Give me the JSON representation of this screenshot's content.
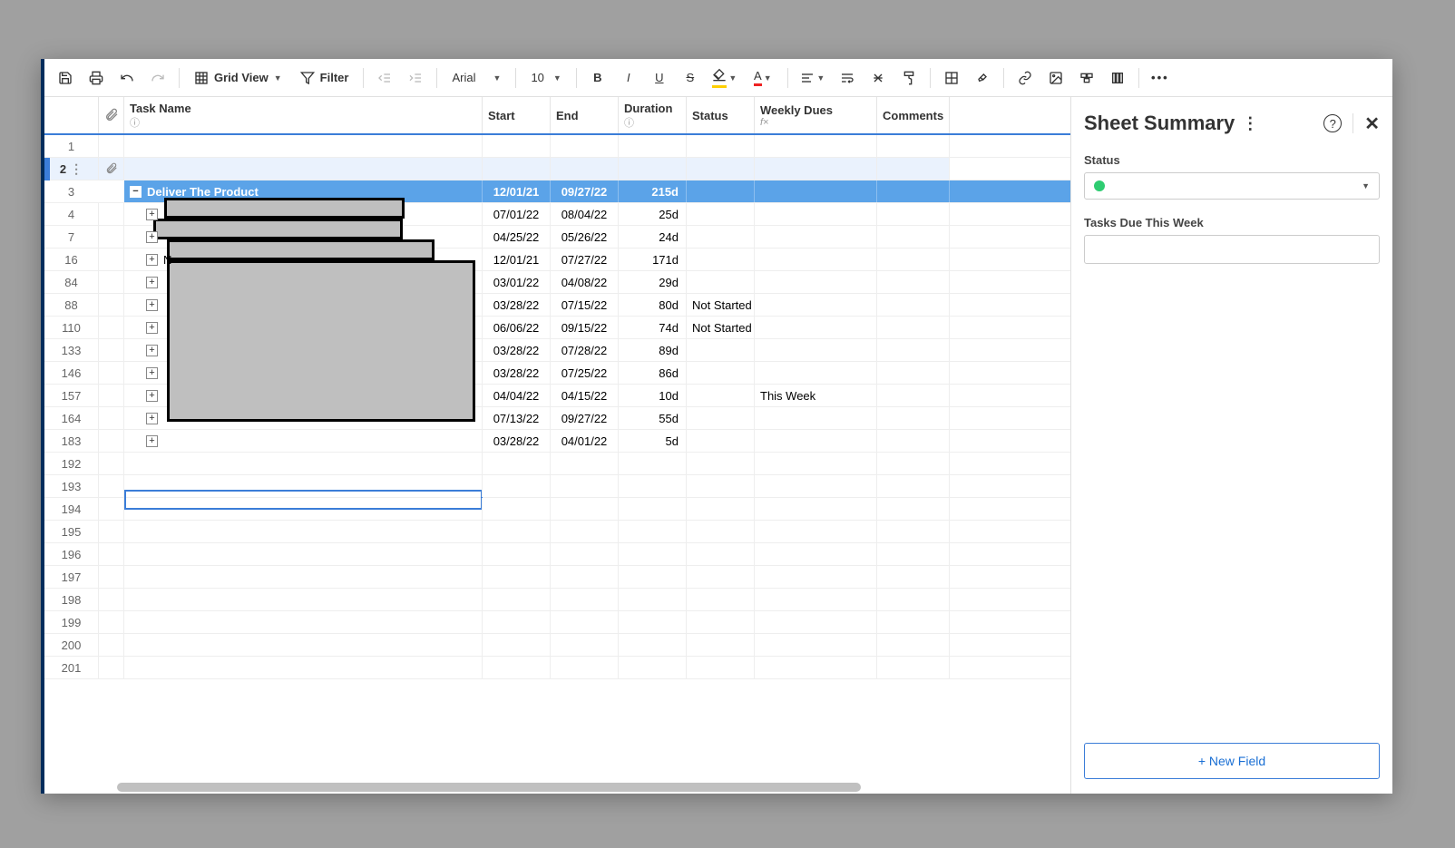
{
  "toolbar": {
    "view_label": "Grid View",
    "filter_label": "Filter",
    "font_label": "Arial",
    "font_size": "10"
  },
  "columns": {
    "task": "Task Name",
    "start": "Start",
    "end": "End",
    "duration": "Duration",
    "status": "Status",
    "weekly": "Weekly Dues",
    "comments": "Comments"
  },
  "rows": [
    {
      "num": "1",
      "task": "",
      "start": "",
      "end": "",
      "duration": "",
      "status": "",
      "weekly": "",
      "indent": 0,
      "expand": "",
      "parent": false,
      "highlight": false
    },
    {
      "num": "2",
      "task": "",
      "start": "",
      "end": "",
      "duration": "",
      "status": "",
      "weekly": "",
      "indent": 0,
      "expand": "",
      "parent": false,
      "highlight": true,
      "attach": true,
      "menu": true
    },
    {
      "num": "3",
      "task": "Deliver The Product",
      "start": "12/01/21",
      "end": "09/27/22",
      "duration": "215d",
      "status": "",
      "weekly": "",
      "indent": 0,
      "expand": "−",
      "parent": true,
      "highlight": false
    },
    {
      "num": "4",
      "task": "",
      "start": "07/01/22",
      "end": "08/04/22",
      "duration": "25d",
      "status": "",
      "weekly": "",
      "indent": 1,
      "expand": "+",
      "parent": false,
      "highlight": false
    },
    {
      "num": "7",
      "task": "",
      "start": "04/25/22",
      "end": "05/26/22",
      "duration": "24d",
      "status": "",
      "weekly": "",
      "indent": 1,
      "expand": "+",
      "parent": false,
      "highlight": false
    },
    {
      "num": "16",
      "task": "N",
      "start": "12/01/21",
      "end": "07/27/22",
      "duration": "171d",
      "status": "",
      "weekly": "",
      "indent": 1,
      "expand": "+",
      "parent": false,
      "highlight": false
    },
    {
      "num": "84",
      "task": "",
      "start": "03/01/22",
      "end": "04/08/22",
      "duration": "29d",
      "status": "",
      "weekly": "",
      "indent": 1,
      "expand": "+",
      "parent": false,
      "highlight": false
    },
    {
      "num": "88",
      "task": "",
      "start": "03/28/22",
      "end": "07/15/22",
      "duration": "80d",
      "status": "Not Started",
      "weekly": "",
      "indent": 1,
      "expand": "+",
      "parent": false,
      "highlight": false
    },
    {
      "num": "110",
      "task": "",
      "start": "06/06/22",
      "end": "09/15/22",
      "duration": "74d",
      "status": "Not Started",
      "weekly": "",
      "indent": 1,
      "expand": "+",
      "parent": false,
      "highlight": false
    },
    {
      "num": "133",
      "task": "",
      "start": "03/28/22",
      "end": "07/28/22",
      "duration": "89d",
      "status": "",
      "weekly": "",
      "indent": 1,
      "expand": "+",
      "parent": false,
      "highlight": false
    },
    {
      "num": "146",
      "task": "",
      "start": "03/28/22",
      "end": "07/25/22",
      "duration": "86d",
      "status": "",
      "weekly": "",
      "indent": 1,
      "expand": "+",
      "parent": false,
      "highlight": false
    },
    {
      "num": "157",
      "task": "",
      "start": "04/04/22",
      "end": "04/15/22",
      "duration": "10d",
      "status": "",
      "weekly": "This Week",
      "indent": 1,
      "expand": "+",
      "parent": false,
      "highlight": false
    },
    {
      "num": "164",
      "task": "",
      "start": "07/13/22",
      "end": "09/27/22",
      "duration": "55d",
      "status": "",
      "weekly": "",
      "indent": 1,
      "expand": "+",
      "parent": false,
      "highlight": false
    },
    {
      "num": "183",
      "task": "",
      "start": "03/28/22",
      "end": "04/01/22",
      "duration": "5d",
      "status": "",
      "weekly": "",
      "indent": 1,
      "expand": "+",
      "parent": false,
      "highlight": false
    },
    {
      "num": "192",
      "task": "",
      "start": "",
      "end": "",
      "duration": "",
      "status": "",
      "weekly": "",
      "indent": 0,
      "expand": "",
      "parent": false,
      "highlight": false
    },
    {
      "num": "193",
      "task": "",
      "start": "",
      "end": "",
      "duration": "",
      "status": "",
      "weekly": "",
      "indent": 0,
      "expand": "",
      "parent": false,
      "highlight": false
    },
    {
      "num": "194",
      "task": "",
      "start": "",
      "end": "",
      "duration": "",
      "status": "",
      "weekly": "",
      "indent": 0,
      "expand": "",
      "parent": false,
      "highlight": false
    },
    {
      "num": "195",
      "task": "",
      "start": "",
      "end": "",
      "duration": "",
      "status": "",
      "weekly": "",
      "indent": 0,
      "expand": "",
      "parent": false,
      "highlight": false
    },
    {
      "num": "196",
      "task": "",
      "start": "",
      "end": "",
      "duration": "",
      "status": "",
      "weekly": "",
      "indent": 0,
      "expand": "",
      "parent": false,
      "highlight": false
    },
    {
      "num": "197",
      "task": "",
      "start": "",
      "end": "",
      "duration": "",
      "status": "",
      "weekly": "",
      "indent": 0,
      "expand": "",
      "parent": false,
      "highlight": false
    },
    {
      "num": "198",
      "task": "",
      "start": "",
      "end": "",
      "duration": "",
      "status": "",
      "weekly": "",
      "indent": 0,
      "expand": "",
      "parent": false,
      "highlight": false
    },
    {
      "num": "199",
      "task": "",
      "start": "",
      "end": "",
      "duration": "",
      "status": "",
      "weekly": "",
      "indent": 0,
      "expand": "",
      "parent": false,
      "highlight": false
    },
    {
      "num": "200",
      "task": "",
      "start": "",
      "end": "",
      "duration": "",
      "status": "",
      "weekly": "",
      "indent": 0,
      "expand": "",
      "parent": false,
      "highlight": false
    },
    {
      "num": "201",
      "task": "",
      "start": "",
      "end": "",
      "duration": "",
      "status": "",
      "weekly": "",
      "indent": 0,
      "expand": "",
      "parent": false,
      "highlight": false
    }
  ],
  "summary": {
    "title": "Sheet Summary",
    "status_label": "Status",
    "tasks_due_label": "Tasks Due This Week",
    "new_field_label": "+ New Field"
  }
}
